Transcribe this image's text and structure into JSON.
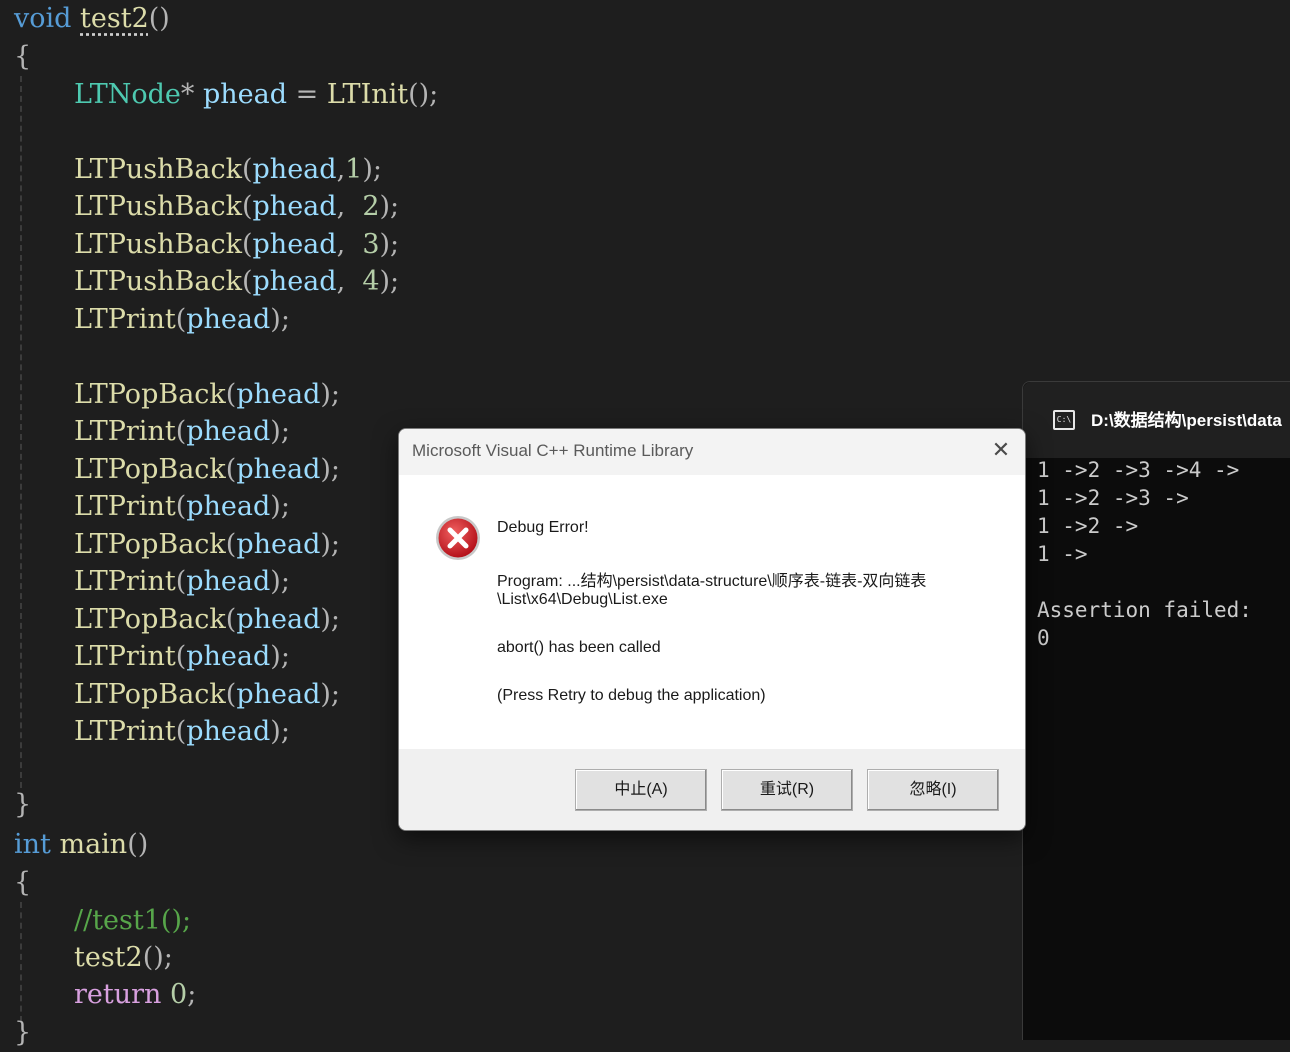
{
  "editor": {
    "lines": [
      {
        "parts": [
          {
            "t": "void",
            "c": "kw"
          },
          {
            "t": " ",
            "c": ""
          },
          {
            "t": "test2",
            "c": "fn squig"
          },
          {
            "t": "()",
            "c": "op"
          }
        ]
      },
      {
        "parts": [
          {
            "t": "{",
            "c": "op"
          }
        ]
      },
      {
        "parts": [
          {
            "t": "LTNode",
            "c": "typ"
          },
          {
            "t": "* ",
            "c": "op"
          },
          {
            "t": "phead",
            "c": "var"
          },
          {
            "t": " = ",
            "c": "op"
          },
          {
            "t": "LTInit",
            "c": "fn"
          },
          {
            "t": "();",
            "c": "op"
          }
        ]
      },
      {
        "parts": []
      },
      {
        "parts": [
          {
            "t": "LTPushBack",
            "c": "fn"
          },
          {
            "t": "(",
            "c": "op"
          },
          {
            "t": "phead",
            "c": "var"
          },
          {
            "t": ",",
            "c": "op"
          },
          {
            "t": "1",
            "c": "num"
          },
          {
            "t": ");",
            "c": "op"
          }
        ]
      },
      {
        "parts": [
          {
            "t": "LTPushBack",
            "c": "fn"
          },
          {
            "t": "(",
            "c": "op"
          },
          {
            "t": "phead",
            "c": "var"
          },
          {
            "t": ",  ",
            "c": "op"
          },
          {
            "t": "2",
            "c": "num"
          },
          {
            "t": ");",
            "c": "op"
          }
        ]
      },
      {
        "parts": [
          {
            "t": "LTPushBack",
            "c": "fn"
          },
          {
            "t": "(",
            "c": "op"
          },
          {
            "t": "phead",
            "c": "var"
          },
          {
            "t": ",  ",
            "c": "op"
          },
          {
            "t": "3",
            "c": "num"
          },
          {
            "t": ");",
            "c": "op"
          }
        ]
      },
      {
        "parts": [
          {
            "t": "LTPushBack",
            "c": "fn"
          },
          {
            "t": "(",
            "c": "op"
          },
          {
            "t": "phead",
            "c": "var"
          },
          {
            "t": ",  ",
            "c": "op"
          },
          {
            "t": "4",
            "c": "num"
          },
          {
            "t": ");",
            "c": "op"
          }
        ]
      },
      {
        "parts": [
          {
            "t": "LTPrint",
            "c": "fn"
          },
          {
            "t": "(",
            "c": "op"
          },
          {
            "t": "phead",
            "c": "var"
          },
          {
            "t": ");",
            "c": "op"
          }
        ]
      },
      {
        "parts": []
      },
      {
        "parts": [
          {
            "t": "LTPopBack",
            "c": "fn"
          },
          {
            "t": "(",
            "c": "op"
          },
          {
            "t": "phead",
            "c": "var"
          },
          {
            "t": ");",
            "c": "op"
          }
        ]
      },
      {
        "parts": [
          {
            "t": "LTPrint",
            "c": "fn"
          },
          {
            "t": "(",
            "c": "op"
          },
          {
            "t": "phead",
            "c": "var"
          },
          {
            "t": ");",
            "c": "op"
          }
        ]
      },
      {
        "parts": [
          {
            "t": "LTPopBack",
            "c": "fn"
          },
          {
            "t": "(",
            "c": "op"
          },
          {
            "t": "phead",
            "c": "var"
          },
          {
            "t": ");",
            "c": "op"
          }
        ]
      },
      {
        "parts": [
          {
            "t": "LTPrint",
            "c": "fn"
          },
          {
            "t": "(",
            "c": "op"
          },
          {
            "t": "phead",
            "c": "var"
          },
          {
            "t": ");",
            "c": "op"
          }
        ]
      },
      {
        "parts": [
          {
            "t": "LTPopBack",
            "c": "fn"
          },
          {
            "t": "(",
            "c": "op"
          },
          {
            "t": "phead",
            "c": "var"
          },
          {
            "t": ");",
            "c": "op"
          }
        ]
      },
      {
        "parts": [
          {
            "t": "LTPrint",
            "c": "fn"
          },
          {
            "t": "(",
            "c": "op"
          },
          {
            "t": "phead",
            "c": "var"
          },
          {
            "t": ");",
            "c": "op"
          }
        ]
      },
      {
        "parts": [
          {
            "t": "LTPopBack",
            "c": "fn"
          },
          {
            "t": "(",
            "c": "op"
          },
          {
            "t": "phead",
            "c": "var"
          },
          {
            "t": ");",
            "c": "op"
          }
        ]
      },
      {
        "parts": [
          {
            "t": "LTPrint",
            "c": "fn"
          },
          {
            "t": "(",
            "c": "op"
          },
          {
            "t": "phead",
            "c": "var"
          },
          {
            "t": ");",
            "c": "op"
          }
        ]
      },
      {
        "parts": [
          {
            "t": "LTPopBack",
            "c": "fn"
          },
          {
            "t": "(",
            "c": "op"
          },
          {
            "t": "phead",
            "c": "var"
          },
          {
            "t": ");",
            "c": "op"
          }
        ]
      },
      {
        "parts": [
          {
            "t": "LTPrint",
            "c": "fn"
          },
          {
            "t": "(",
            "c": "op"
          },
          {
            "t": "phead",
            "c": "var"
          },
          {
            "t": ");",
            "c": "op"
          }
        ]
      },
      {
        "parts": []
      },
      {
        "parts": [
          {
            "t": "}",
            "c": "op"
          }
        ]
      },
      {
        "parts": [
          {
            "t": "int",
            "c": "kw"
          },
          {
            "t": " ",
            "c": ""
          },
          {
            "t": "main",
            "c": "fn"
          },
          {
            "t": "()",
            "c": "op"
          }
        ]
      },
      {
        "parts": [
          {
            "t": "{",
            "c": "op"
          }
        ]
      },
      {
        "parts": [
          {
            "t": "//test1();",
            "c": "cmt"
          }
        ]
      },
      {
        "parts": [
          {
            "t": "test2",
            "c": "fn"
          },
          {
            "t": "();",
            "c": "op"
          }
        ]
      },
      {
        "parts": [
          {
            "t": "return",
            "c": "ctl"
          },
          {
            "t": " ",
            "c": ""
          },
          {
            "t": "0",
            "c": "num"
          },
          {
            "t": ";",
            "c": "op"
          }
        ]
      },
      {
        "parts": [
          {
            "t": "}",
            "c": "op"
          }
        ]
      }
    ]
  },
  "console": {
    "title": "D:\\数据结构\\persist\\data",
    "output_lines": [
      "1 ->2 ->3 ->4 ->",
      "1 ->2 ->3 ->",
      "1 ->2 ->",
      "1 ->",
      "",
      "Assertion failed:",
      "0"
    ]
  },
  "dialog": {
    "title": "Microsoft Visual C++ Runtime Library",
    "heading": "Debug Error!",
    "program_line1": "Program: ...结构\\persist\\data-structure\\顺序表-链表-双向链表",
    "program_line2": "\\List\\x64\\Debug\\List.exe",
    "abort_text": "abort() has been called",
    "hint_text": "(Press Retry to debug the application)",
    "buttons": {
      "abort": "中止(A)",
      "retry": "重试(R)",
      "ignore": "忽略(I)"
    }
  },
  "colors": {
    "editor_bg": "#1e1e1e",
    "keyword": "#569cd6",
    "control": "#d8a0df",
    "type": "#4ec9b0",
    "function": "#dcdcaa",
    "variable": "#9cdcfe",
    "number": "#b5cea8",
    "comment": "#57a64a",
    "error_red": "#d4202a"
  },
  "icons": {
    "error": "error-x-circle-icon",
    "close": "close-icon",
    "console": "console-window-icon"
  }
}
